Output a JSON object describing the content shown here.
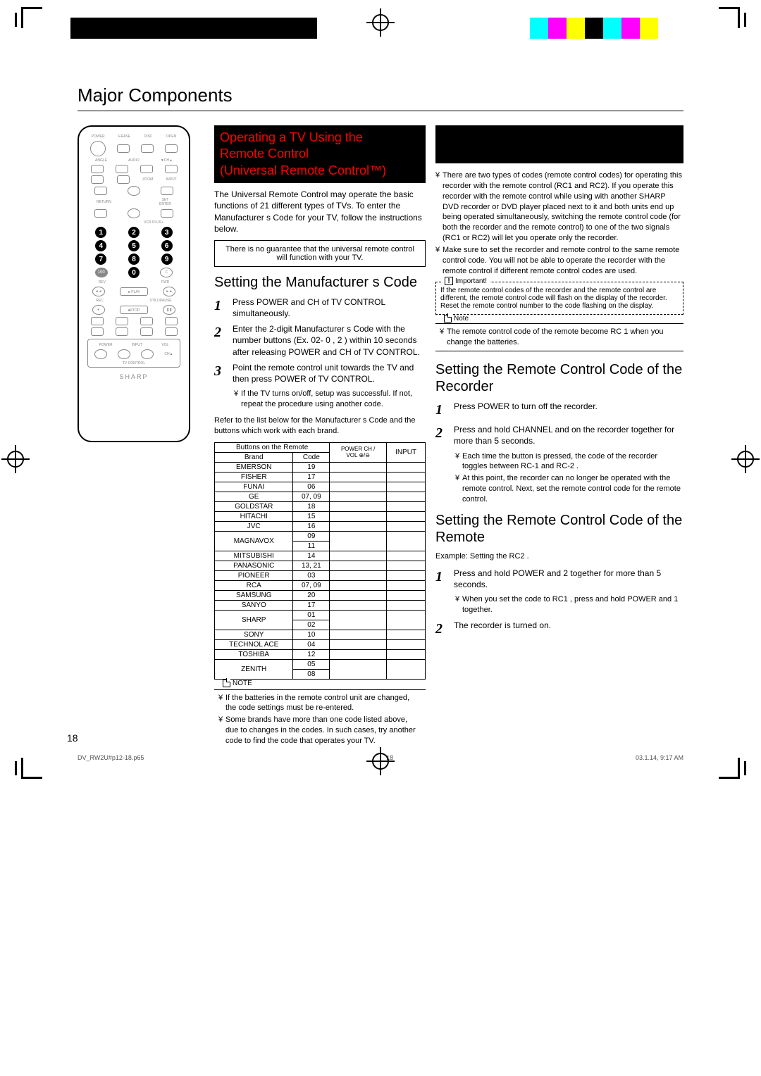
{
  "page_title": "Major Components",
  "col2": {
    "heading_lines": [
      "Operating a TV Using the",
      "Remote Control",
      "(Universal Remote Control™)"
    ],
    "intro": "The Universal Remote Control may operate the basic functions of 21 different types of TVs. To enter the Manufacturer s Code for your TV, follow the instructions below.",
    "disclaimer": "There is no guarantee that the universal remote control will function with your TV.",
    "sub_heading": "Setting the Manufacturer s Code",
    "steps": [
      "Press POWER and CH of TV CONTROL simultaneously.",
      "Enter the 2-digit Manufacturer s Code with the number buttons (Ex. 02- 0 , 2 ) within 10 seconds after releasing POWER and CH of TV CONTROL.",
      "Point the remote control unit towards the TV and then press POWER of TV CONTROL."
    ],
    "step3_bullet": "If the TV turns on/off, setup was successful. If not, repeat the procedure using another code.",
    "table_intro": "Refer to the list below for the Manufacturer s Code and the buttons which work with each brand.",
    "table": {
      "head_left": "Buttons on the Remote",
      "head_brand": "Brand",
      "head_code": "Code",
      "head_power": "POWER CH /",
      "head_vol": "VOL ⊕/⊖",
      "head_input": "INPUT",
      "rows": [
        {
          "brand": "EMERSON",
          "code": "19"
        },
        {
          "brand": "FISHER",
          "code": "17"
        },
        {
          "brand": "FUNAI",
          "code": "06"
        },
        {
          "brand": "GE",
          "code": "07, 09"
        },
        {
          "brand": "GOLDSTAR",
          "code": "18"
        },
        {
          "brand": "HITACHI",
          "code": "15"
        },
        {
          "brand": "JVC",
          "code": "16"
        },
        {
          "brand": "MAGNAVOX",
          "code": "09",
          "split": "11"
        },
        {
          "brand": "MITSUBISHI",
          "code": "14"
        },
        {
          "brand": "PANASONIC",
          "code": "13, 21"
        },
        {
          "brand": "PIONEER",
          "code": "03"
        },
        {
          "brand": "RCA",
          "code": "07, 09"
        },
        {
          "brand": "SAMSUNG",
          "code": "20"
        },
        {
          "brand": "SANYO",
          "code": "17"
        },
        {
          "brand": "SHARP",
          "code": "01",
          "split": "02"
        },
        {
          "brand": "SONY",
          "code": "10"
        },
        {
          "brand": "TECHNOL ACE",
          "code": "04"
        },
        {
          "brand": "TOSHIBA",
          "code": "12"
        },
        {
          "brand": "ZENITH",
          "code": "05",
          "split": "08"
        }
      ]
    },
    "note_label": "NOTE",
    "note_items": [
      "If the batteries in the remote control unit are changed, the code settings must be re-entered.",
      "Some brands have more than one code listed above, due to changes in the codes. In such cases, try another code to find the code that operates your TV."
    ]
  },
  "col3": {
    "intro_bullets": [
      "There are two types of codes (remote control codes) for operating this recorder with the remote control (RC1 and RC2). If you operate this recorder with the remote control while using with another SHARP DVD recorder or DVD player placed next to it and both units end up being operated simultaneously, switching the remote control code (for both the recorder and the remote control) to one of the two signals (RC1 or RC2) will let you operate only the recorder.",
      "Make sure to set the recorder and remote control to the same remote control code. You will not be able to operate the recorder with the remote control if different remote control codes are used."
    ],
    "important_label": "Important!",
    "important_text": "If the remote control codes of the recorder and the remote control are different, the remote control code will flash on the display of the recorder. Reset the remote control number to the code flashing on the display.",
    "note_label": "Note",
    "note_text": "The remote control code of the remote become RC 1 when you change the batteries.",
    "sub1": "Setting the Remote Control Code of the Recorder",
    "sub1_steps": [
      "Press POWER to turn off the recorder.",
      "Press and hold CHANNEL and on the recorder together for more than 5 seconds."
    ],
    "sub1_bullets": [
      "Each time the button is pressed, the code of the recorder toggles between RC-1 and RC-2 .",
      "At this point, the recorder can no longer be operated with the remote control. Next, set the remote control code for the remote control."
    ],
    "sub2": "Setting the Remote Control Code of the Remote",
    "sub2_example": "Example: Setting the RC2 .",
    "sub2_steps": [
      "Press and hold POWER and 2 together for more than 5 seconds.",
      "The recorder is turned on."
    ],
    "sub2_step1_bullet": "When you set the code to RC1 , press and hold POWER and 1 together."
  },
  "remote_brand": "SHARP",
  "page_number": "18",
  "footer_left": "DV_RW2U#p12-18.p65",
  "footer_center": "18",
  "footer_right": "03.1.14, 9:17 AM"
}
